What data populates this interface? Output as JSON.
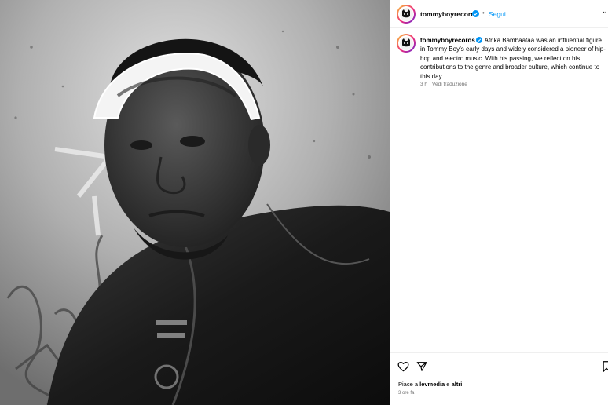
{
  "photo": {
    "alt_icon": "portrait-photo",
    "colors": {
      "wall": "#b5b5b5",
      "jacket": "#1e1e1e",
      "skin": "#3a3a3a",
      "visor": "#f2f2f2"
    }
  },
  "header": {
    "username": "tommyboyrecords",
    "separator": "•",
    "follow_label": "Segui",
    "more_icon": "more-options-icon",
    "more_glyph": "··"
  },
  "caption": {
    "username": "tommyboyrecords",
    "text": "Afrika Bambaataa was an influential figure in Tommy Boy’s early days and widely considered a pioneer of hip-hop and electro music. With his passing, we reflect on his contributions to the genre and broader culture, which continue to this day.",
    "time": "3 h",
    "translate_label": "Vedi traduzione"
  },
  "actions": {
    "likes_prefix": "Piace a ",
    "likes_user": "levmedia",
    "likes_mid": " e ",
    "likes_suffix": "altri",
    "posted_ago": "3 ore fa"
  },
  "colors": {
    "accent": "#0095f6",
    "muted": "#737373",
    "verified": "#0095f6"
  }
}
